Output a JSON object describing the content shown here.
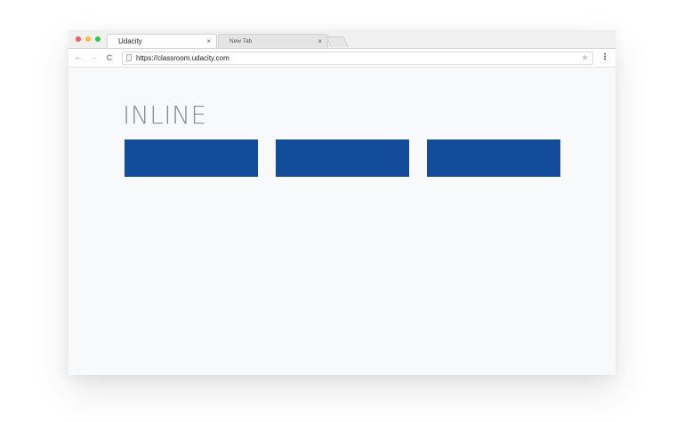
{
  "window": {
    "traffic_lights": [
      {
        "name": "close",
        "color": "#fc5753"
      },
      {
        "name": "minimize",
        "color": "#fdbc40"
      },
      {
        "name": "maximize",
        "color": "#33c748"
      }
    ]
  },
  "tabs": [
    {
      "label": "Udacity",
      "active": true,
      "close_glyph": "×"
    },
    {
      "label": "New Tab",
      "active": false,
      "close_glyph": "×"
    }
  ],
  "toolbar": {
    "back_glyph": "←",
    "forward_glyph": "→",
    "reload_glyph": "C",
    "url": "https://classroom.udacity.com",
    "bookmark_glyph": "★",
    "menu_glyph": "⋮"
  },
  "content": {
    "heading": "INLINE",
    "blocks": [
      {
        "color": "#144c9c"
      },
      {
        "color": "#144c9c"
      },
      {
        "color": "#144c9c"
      }
    ]
  }
}
